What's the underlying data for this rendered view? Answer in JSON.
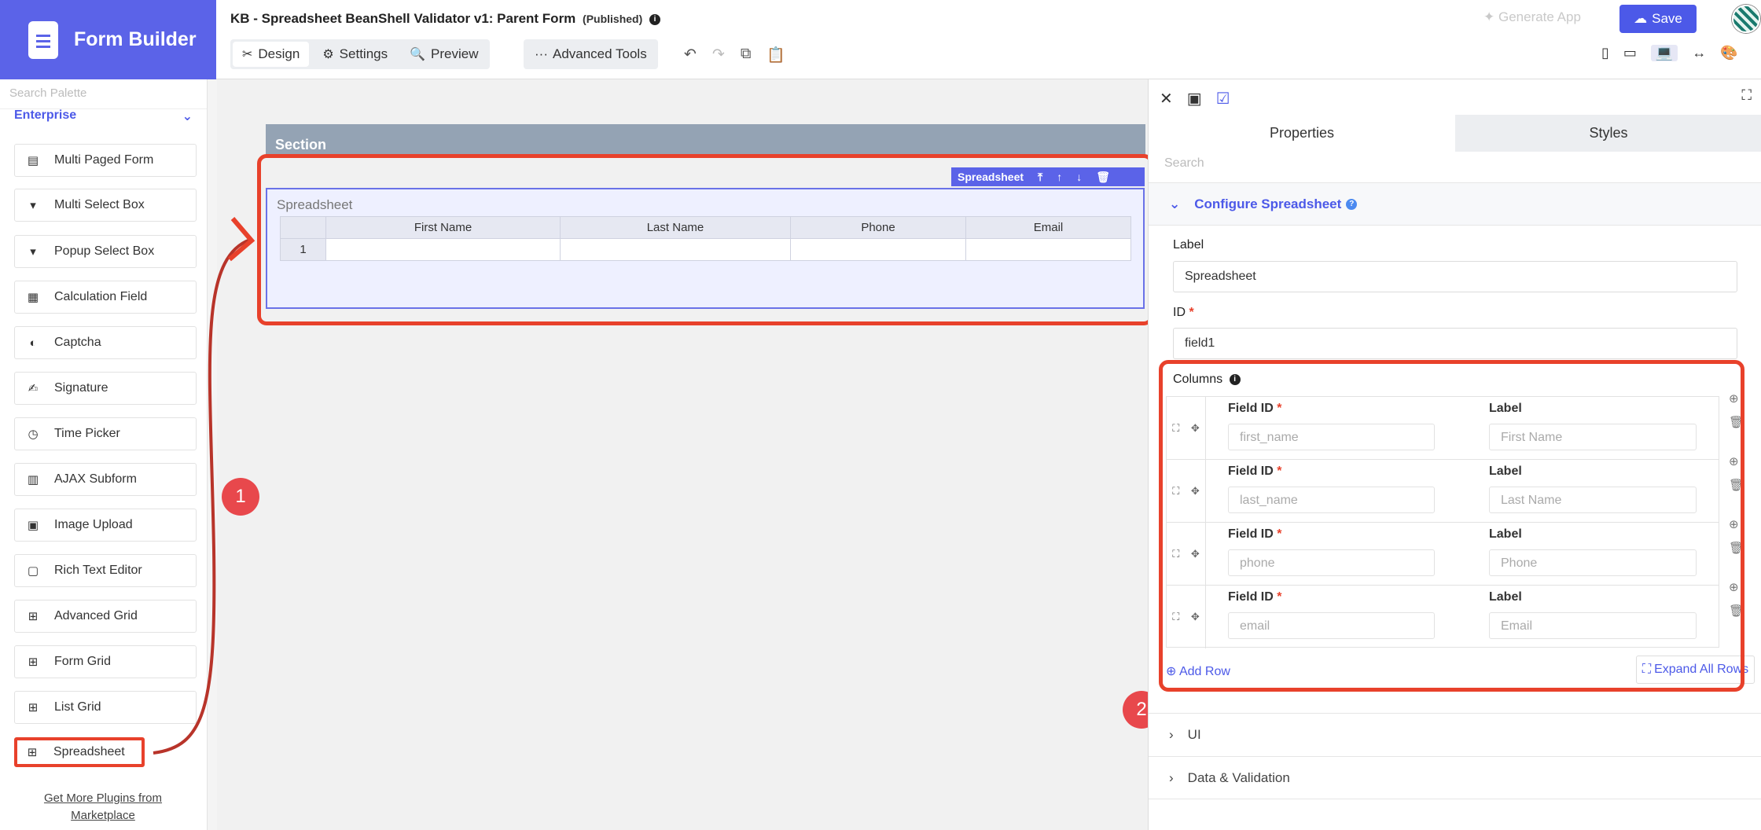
{
  "app": {
    "title": "Form Builder"
  },
  "header": {
    "form_title": "KB - Spreadsheet BeanShell Validator v1: Parent Form",
    "status": "(Published)",
    "tabs": [
      {
        "label": "Design",
        "icon": "design-icon"
      },
      {
        "label": "Settings",
        "icon": "gear-icon"
      },
      {
        "label": "Preview",
        "icon": "preview-icon"
      }
    ],
    "advanced_tools": "Advanced Tools",
    "generate_app": "Generate App",
    "save": "Save"
  },
  "sidebar": {
    "search_placeholder": "Search Palette",
    "category": "Enterprise",
    "items": [
      {
        "label": "Multi Paged Form",
        "icon": "multi-page-icon"
      },
      {
        "label": "Multi Select Box",
        "icon": "select-box-icon"
      },
      {
        "label": "Popup Select Box",
        "icon": "select-box-icon"
      },
      {
        "label": "Calculation Field",
        "icon": "calculator-icon"
      },
      {
        "label": "Captcha",
        "icon": "shield-icon"
      },
      {
        "label": "Signature",
        "icon": "signature-icon"
      },
      {
        "label": "Time Picker",
        "icon": "clock-icon"
      },
      {
        "label": "AJAX Subform",
        "icon": "document-icon"
      },
      {
        "label": "Image Upload",
        "icon": "image-icon"
      },
      {
        "label": "Rich Text Editor",
        "icon": "rich-text-icon"
      },
      {
        "label": "Advanced Grid",
        "icon": "grid-icon"
      },
      {
        "label": "Form Grid",
        "icon": "grid-icon"
      },
      {
        "label": "List Grid",
        "icon": "grid-icon"
      },
      {
        "label": "Spreadsheet",
        "icon": "grid-icon"
      }
    ],
    "marketplace_link": "Get More Plugins from Marketplace"
  },
  "canvas": {
    "section_title": "Section",
    "field_toolbar_label": "Spreadsheet",
    "field_label": "Spreadsheet",
    "columns": [
      "First Name",
      "Last Name",
      "Phone",
      "Email"
    ],
    "row_number": "1"
  },
  "annotations": {
    "badge1": "1",
    "badge2": "2"
  },
  "properties": {
    "tabs": [
      "Properties",
      "Styles"
    ],
    "search_placeholder": "Search",
    "section_title": "Configure Spreadsheet",
    "label_label": "Label",
    "label_value": "Spreadsheet",
    "id_label": "ID",
    "id_value": "field1",
    "columns_label": "Columns",
    "field_id_header": "Field ID",
    "label_header": "Label",
    "column_rows": [
      {
        "field_id": "first_name",
        "label": "First Name"
      },
      {
        "field_id": "last_name",
        "label": "Last Name"
      },
      {
        "field_id": "phone",
        "label": "Phone"
      },
      {
        "field_id": "email",
        "label": "Email"
      }
    ],
    "add_row": "Add Row",
    "expand_all": "Expand All Rows",
    "collapsed_sections": [
      "UI",
      "Data & Validation"
    ]
  },
  "colors": {
    "accent": "#5b63e8",
    "highlight": "#e8412b"
  }
}
